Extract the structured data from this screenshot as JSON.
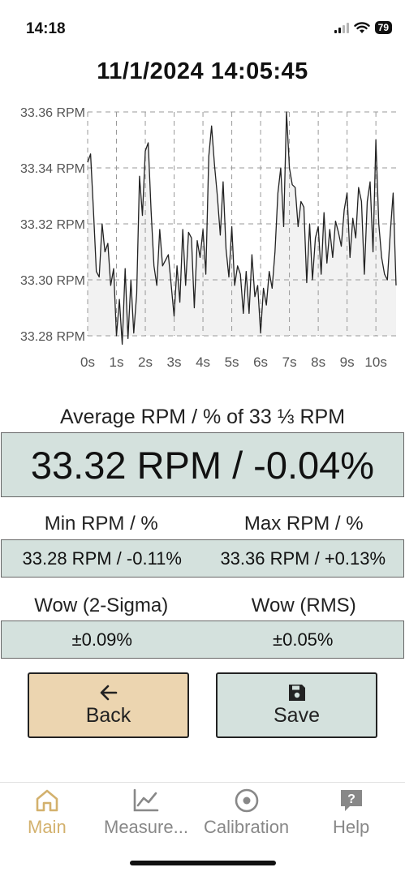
{
  "status_bar": {
    "time": "14:18",
    "battery": "79"
  },
  "timestamp": "11/1/2024 14:05:45",
  "chart_data": {
    "type": "area",
    "x_ticks": [
      "0s",
      "1s",
      "2s",
      "3s",
      "4s",
      "5s",
      "6s",
      "7s",
      "8s",
      "9s",
      "10s"
    ],
    "y_ticks": [
      "33.36 RPM",
      "33.34 RPM",
      "33.32 RPM",
      "33.30 RPM",
      "33.28 RPM"
    ],
    "ylim": [
      33.28,
      33.36
    ],
    "xlim": [
      0,
      10.7
    ],
    "grid": true,
    "x": [
      0,
      0.1,
      0.2,
      0.3,
      0.4,
      0.5,
      0.6,
      0.7,
      0.8,
      0.9,
      1.0,
      1.1,
      1.2,
      1.3,
      1.4,
      1.5,
      1.6,
      1.7,
      1.8,
      1.9,
      2.0,
      2.1,
      2.2,
      2.3,
      2.4,
      2.5,
      2.6,
      2.7,
      2.8,
      2.9,
      3.0,
      3.1,
      3.2,
      3.3,
      3.4,
      3.5,
      3.6,
      3.7,
      3.8,
      3.9,
      4.0,
      4.1,
      4.2,
      4.3,
      4.4,
      4.5,
      4.6,
      4.7,
      4.8,
      4.9,
      5.0,
      5.1,
      5.2,
      5.3,
      5.4,
      5.5,
      5.6,
      5.7,
      5.8,
      5.9,
      6.0,
      6.1,
      6.2,
      6.3,
      6.4,
      6.5,
      6.6,
      6.7,
      6.8,
      6.9,
      7.0,
      7.1,
      7.2,
      7.3,
      7.4,
      7.5,
      7.6,
      7.7,
      7.8,
      7.9,
      8.0,
      8.1,
      8.2,
      8.3,
      8.4,
      8.5,
      8.6,
      8.7,
      8.8,
      8.9,
      9.0,
      9.1,
      9.2,
      9.3,
      9.4,
      9.5,
      9.6,
      9.7,
      9.8,
      9.9,
      10.0,
      10.1,
      10.2,
      10.3,
      10.4,
      10.5,
      10.6,
      10.7
    ],
    "values": [
      33.342,
      33.345,
      33.325,
      33.303,
      33.301,
      33.32,
      33.31,
      33.313,
      33.298,
      33.304,
      33.28,
      33.293,
      33.277,
      33.304,
      33.279,
      33.3,
      33.281,
      33.295,
      33.337,
      33.323,
      33.346,
      33.349,
      33.325,
      33.305,
      33.298,
      33.318,
      33.305,
      33.307,
      33.309,
      33.298,
      33.287,
      33.305,
      33.292,
      33.318,
      33.298,
      33.317,
      33.315,
      33.29,
      33.314,
      33.308,
      33.318,
      33.302,
      33.344,
      33.355,
      33.341,
      33.33,
      33.316,
      33.335,
      33.311,
      33.301,
      33.319,
      33.298,
      33.305,
      33.302,
      33.288,
      33.303,
      33.288,
      33.309,
      33.294,
      33.298,
      33.281,
      33.297,
      33.291,
      33.303,
      33.297,
      33.31,
      33.331,
      33.34,
      33.319,
      33.36,
      33.34,
      33.334,
      33.333,
      33.319,
      33.328,
      33.326,
      33.299,
      33.32,
      33.3,
      33.315,
      33.319,
      33.302,
      33.324,
      33.306,
      33.318,
      33.308,
      33.321,
      33.317,
      33.312,
      33.325,
      33.331,
      33.308,
      33.322,
      33.315,
      33.333,
      33.328,
      33.302,
      33.328,
      33.335,
      33.31,
      33.35,
      33.32,
      33.308,
      33.302,
      33.3,
      33.317,
      33.331,
      33.298
    ],
    "line_color": "#222222",
    "fill_color": "#f2f2f2",
    "grid_color": "#999999"
  },
  "average": {
    "title": "Average RPM / % of 33 ⅓ RPM",
    "value": "33.32 RPM / -0.04%"
  },
  "min_max": {
    "min_label": "Min RPM / %",
    "max_label": "Max RPM / %",
    "min_value": "33.28 RPM / -0.11%",
    "max_value": "33.36 RPM / +0.13%"
  },
  "wow": {
    "sigma_label": "Wow (2-Sigma)",
    "rms_label": "Wow (RMS)",
    "sigma_value": "±0.09%",
    "rms_value": "±0.05%"
  },
  "buttons": {
    "back_label": "Back",
    "save_label": "Save"
  },
  "colors": {
    "back_bg": "#ecd5b0",
    "panel_bg": "#d4e1dd",
    "accent": "#d3b16d"
  },
  "tabs": [
    {
      "label": "Main",
      "icon": "home-icon",
      "active": true
    },
    {
      "label": "Measure...",
      "icon": "chart-line-icon",
      "active": false
    },
    {
      "label": "Calibration",
      "icon": "target-icon",
      "active": false
    },
    {
      "label": "Help",
      "icon": "help-icon",
      "active": false
    }
  ]
}
